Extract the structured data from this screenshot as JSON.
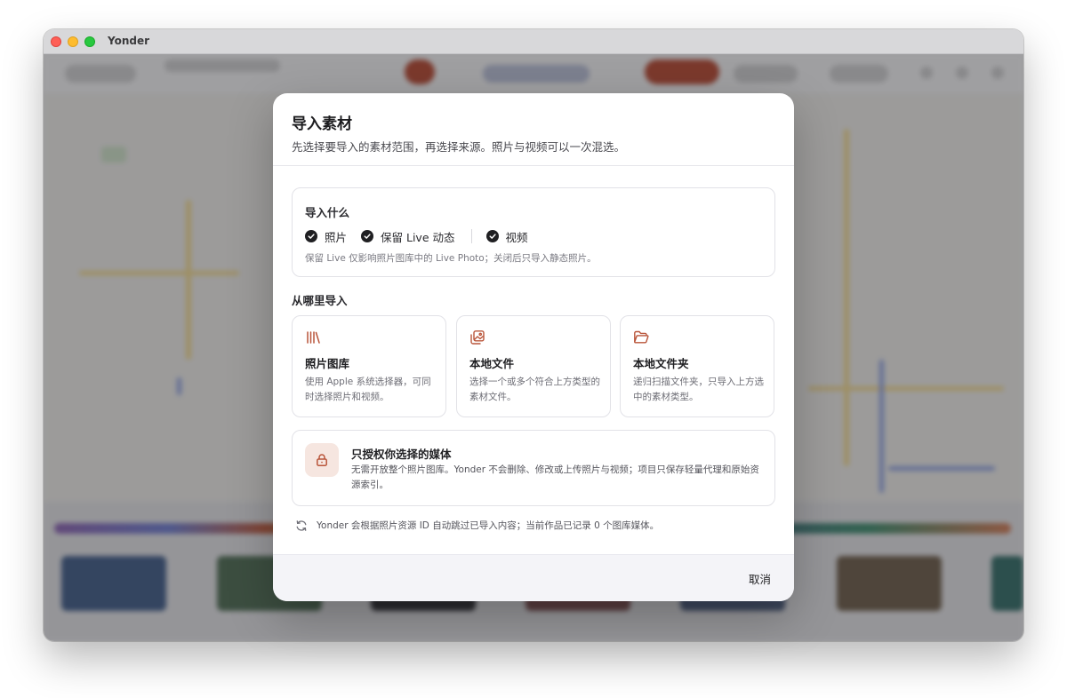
{
  "window": {
    "title": "Yonder"
  },
  "modal": {
    "title": "导入素材",
    "subtitle": "先选择要导入的素材范围，再选择来源。照片与视频可以一次混选。",
    "what": {
      "title": "导入什么",
      "options": [
        {
          "label": "照片",
          "checked": true
        },
        {
          "label": "保留 Live 动态",
          "checked": true
        },
        {
          "label": "视频",
          "checked": true
        }
      ],
      "hint": "保留 Live 仅影响照片图库中的 Live Photo；关闭后只导入静态照片。"
    },
    "from_title": "从哪里导入",
    "sources": [
      {
        "icon": "library-icon",
        "title": "照片图库",
        "desc": "使用 Apple 系统选择器，可同时选择照片和视频。"
      },
      {
        "icon": "photo-files-icon",
        "title": "本地文件",
        "desc": "选择一个或多个符合上方类型的素材文件。"
      },
      {
        "icon": "folder-icon",
        "title": "本地文件夹",
        "desc": "递归扫描文件夹，只导入上方选中的素材类型。"
      }
    ],
    "auth": {
      "title": "只授权你选择的媒体",
      "desc": "无需开放整个照片图库。Yonder 不会删除、修改或上传照片与视频；项目只保存轻量代理和原始资源索引。"
    },
    "dedupe_text": "Yonder 会根据照片资源 ID 自动跳过已导入内容；当前作品已记录 0 个图库媒体。",
    "cancel_label": "取消"
  },
  "colors": {
    "accent": "#b9553a",
    "check": "#1f1f22"
  }
}
